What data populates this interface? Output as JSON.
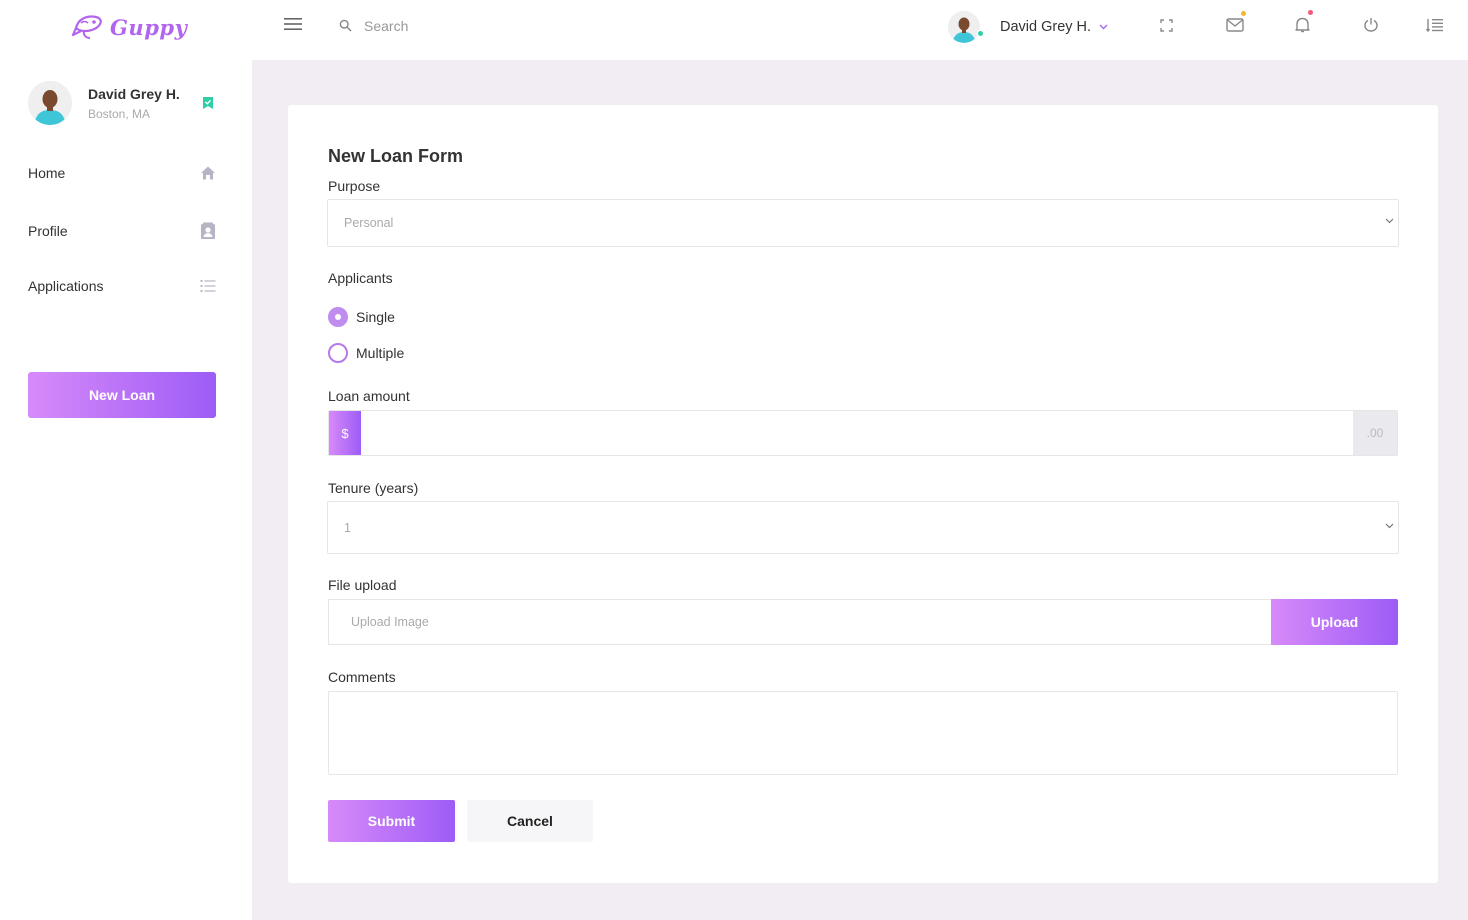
{
  "app": {
    "name": "Guppy"
  },
  "user": {
    "name": "David Grey H.",
    "location": "Boston, MA"
  },
  "sidebar": {
    "items": [
      {
        "label": "Home",
        "icon": "home-icon"
      },
      {
        "label": "Profile",
        "icon": "contact-card-icon"
      },
      {
        "label": "Applications",
        "icon": "list-icon"
      }
    ],
    "new_loan_label": "New Loan"
  },
  "header": {
    "search_placeholder": "Search",
    "user_name": "David Grey H.",
    "icons": [
      "fullscreen-icon",
      "mail-icon",
      "bell-icon",
      "power-icon",
      "indent-list-icon"
    ]
  },
  "form": {
    "title": "New Loan Form",
    "purpose": {
      "label": "Purpose",
      "value": "Personal"
    },
    "applicants": {
      "label": "Applicants",
      "options": [
        "Single",
        "Multiple"
      ],
      "selected": "Single"
    },
    "amount": {
      "label": "Loan amount",
      "prefix": "$",
      "suffix": ".00",
      "value": ""
    },
    "tenure": {
      "label": "Tenure (years)",
      "value": "1"
    },
    "file": {
      "label": "File upload",
      "placeholder": "Upload Image",
      "button_label": "Upload"
    },
    "comments": {
      "label": "Comments",
      "value": ""
    },
    "submit_label": "Submit",
    "cancel_label": "Cancel"
  },
  "colors": {
    "brand": "#b265ee",
    "gradient_start": "#d78af9",
    "gradient_end": "#9d5cf6",
    "online": "#2fcfa6",
    "mail_badge": "#f5b82e",
    "bell_badge": "#f5587a"
  }
}
